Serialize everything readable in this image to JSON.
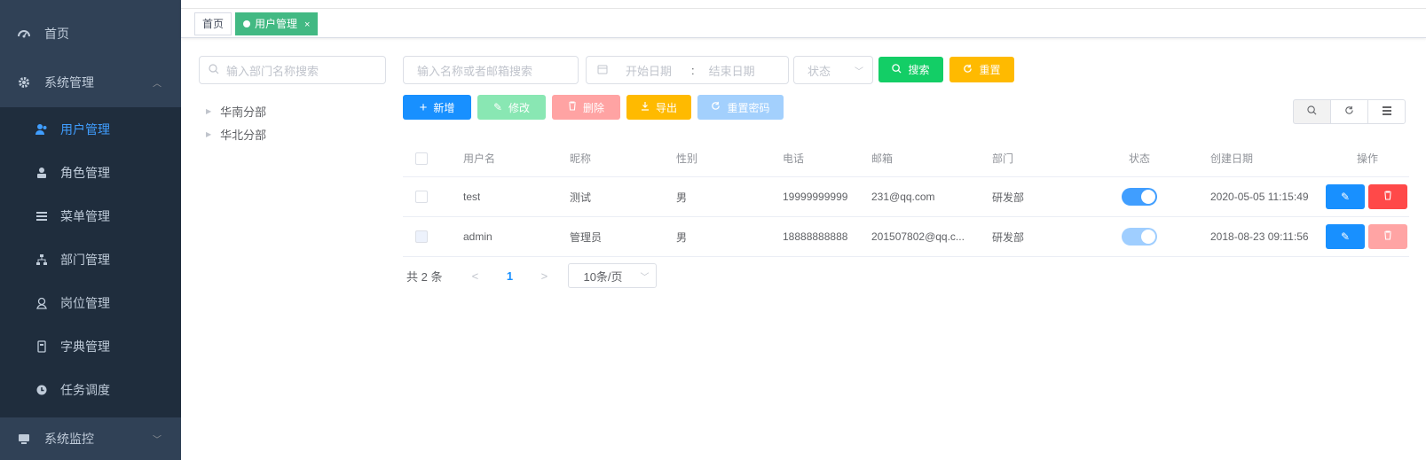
{
  "sidebar": {
    "home": "首页",
    "system": "系统管理",
    "sub_items": [
      {
        "label": "用户管理",
        "icon": "user-icon",
        "active": true
      },
      {
        "label": "角色管理",
        "icon": "role-icon",
        "active": false
      },
      {
        "label": "菜单管理",
        "icon": "menu-icon",
        "active": false
      },
      {
        "label": "部门管理",
        "icon": "dept-icon",
        "active": false
      },
      {
        "label": "岗位管理",
        "icon": "job-icon",
        "active": false
      },
      {
        "label": "字典管理",
        "icon": "dict-icon",
        "active": false
      },
      {
        "label": "任务调度",
        "icon": "timing-icon",
        "active": false
      }
    ],
    "monitor": "系统监控"
  },
  "tags": {
    "home": "首页",
    "active": "用户管理",
    "close": "×"
  },
  "dept": {
    "search_placeholder": "输入部门名称搜索",
    "nodes": [
      "华南分部",
      "华北分部"
    ]
  },
  "filters": {
    "keyword_placeholder": "输入名称或者邮箱搜索",
    "start_placeholder": "开始日期",
    "range_sep": ":",
    "end_placeholder": "结束日期",
    "status_placeholder": "状态",
    "search_label": "搜索",
    "reset_label": "重置"
  },
  "toolbar": {
    "add": "新增",
    "edit": "修改",
    "delete": "删除",
    "export": "导出",
    "reset_pwd": "重置密码"
  },
  "table": {
    "headers": [
      "用户名",
      "昵称",
      "性别",
      "电话",
      "邮箱",
      "部门",
      "状态",
      "创建日期",
      "操作"
    ],
    "rows": [
      {
        "username": "test",
        "nickname": "测试",
        "gender": "男",
        "phone": "19999999999",
        "email": "231@qq.com",
        "dept": "研发部",
        "enabled": true,
        "created": "2020-05-05 11:15:49",
        "disabled": false
      },
      {
        "username": "admin",
        "nickname": "管理员",
        "gender": "男",
        "phone": "18888888888",
        "email": "201507802@qq.c...",
        "dept": "研发部",
        "enabled": true,
        "created": "2018-08-23 09:11:56",
        "disabled": true
      }
    ]
  },
  "pager": {
    "total": "共 2 条",
    "prev": "<",
    "page": "1",
    "next": ">",
    "size": "10条/页"
  },
  "colors": {
    "sidebar_bg": "#304156",
    "submenu_bg": "#1f2d3d",
    "active_text": "#409eff",
    "tag_active": "#42b983",
    "primary": "#1890ff",
    "success": "#13ce66",
    "warning": "#ffba00",
    "danger": "#ff4949"
  }
}
